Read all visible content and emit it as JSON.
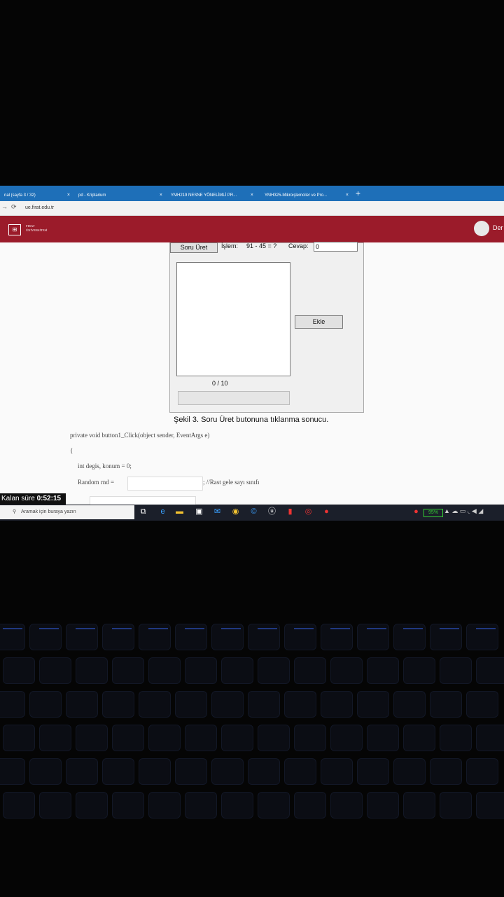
{
  "browser": {
    "tabs": [
      {
        "label": "nal (sayfa 3 / 32)"
      },
      {
        "label": "pd - Kriptarium"
      },
      {
        "label": "YMH219 NESNE YÖNELİMLİ PR..."
      },
      {
        "label": "YMH325-Mikroişlemciler ve Pro..."
      }
    ],
    "new_tab": "+",
    "close_glyph": "×",
    "url": "ue.firat.edu.tr"
  },
  "site": {
    "logo_line1": "FIRAT",
    "logo_line2": "ÜNİVERSİTESİ",
    "user_name": "Der"
  },
  "form": {
    "soru_uret_label": "Soru Üret",
    "islem_label": "İşlem:",
    "islem_value": "91 - 45 = ?",
    "cevap_label": "Cevap:",
    "cevap_value": "0",
    "ekle_label": "Ekle",
    "counter": "0 / 10",
    "progress": 0
  },
  "caption": "Şekil 3. Soru Üret butonuna tıklanma sonucu.",
  "code": {
    "line1": "private void button1_Click(object sender, EventArgs e)",
    "line2": "{",
    "line3": "int degis, konum = 0;",
    "line4_prefix": "Random rnd =",
    "line4_suffix": "; //Rast gele sayı sınıfı"
  },
  "timer": {
    "label": "Kalan süre",
    "value": "0:52:15"
  },
  "taskbar": {
    "search_placeholder": "Aramak için buraya yazın",
    "battery": "95%"
  },
  "colors": {
    "header": "#9b1b2a",
    "tabbar": "#1e6fb8",
    "taskbar": "#1b1f2a"
  }
}
